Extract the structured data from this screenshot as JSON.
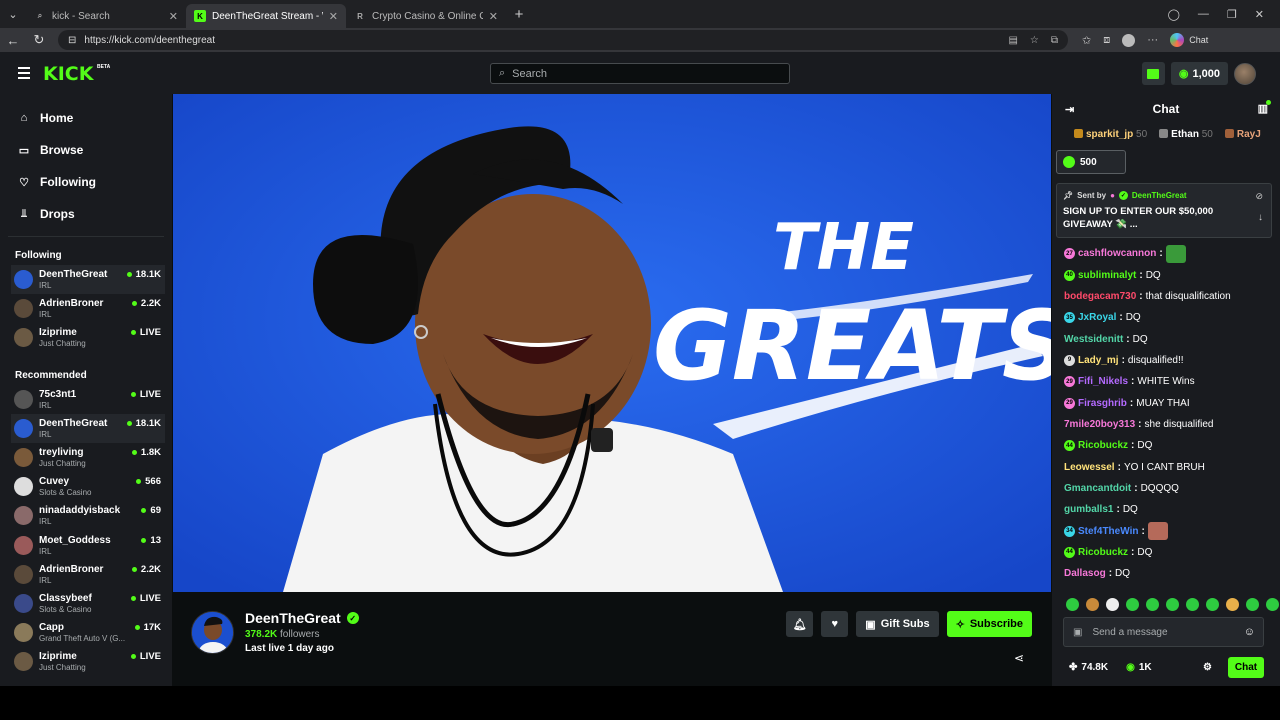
{
  "browser": {
    "tabs": [
      {
        "title": "kick - Search",
        "active": false,
        "favicon": "search-icon"
      },
      {
        "title": "DeenTheGreat Stream - Watch Live",
        "active": true,
        "favicon": "kick-logo-icon"
      },
      {
        "title": "Crypto Casino & Online Gambling",
        "active": false,
        "favicon": "casino-icon"
      }
    ],
    "url": "https://kick.com/deenthegreat",
    "copilot_label": "Chat"
  },
  "header": {
    "logo": "KICK",
    "beta": "BETA",
    "search_placeholder": "Search",
    "coins": "1,000"
  },
  "sidebar": {
    "nav": [
      {
        "label": "Home",
        "icon": "home-icon"
      },
      {
        "label": "Browse",
        "icon": "browse-icon"
      },
      {
        "label": "Following",
        "icon": "heart-icon"
      },
      {
        "label": "Drops",
        "icon": "drops-icon"
      }
    ],
    "following_title": "Following",
    "following": [
      {
        "name": "DeenTheGreat",
        "category": "IRL",
        "viewers": "18.1K",
        "selected": true,
        "color": "#2a5cd0"
      },
      {
        "name": "AdrienBroner",
        "category": "IRL",
        "viewers": "2.2K",
        "selected": false,
        "color": "#5a4a3a"
      },
      {
        "name": "Iziprime",
        "category": "Just Chatting",
        "viewers": "LIVE",
        "selected": false,
        "color": "#6b5a44"
      }
    ],
    "recommended_title": "Recommended",
    "recommended": [
      {
        "name": "75c3nt1",
        "category": "IRL",
        "viewers": "LIVE",
        "selected": false,
        "color": "#555"
      },
      {
        "name": "DeenTheGreat",
        "category": "IRL",
        "viewers": "18.1K",
        "selected": true,
        "color": "#2a5cd0"
      },
      {
        "name": "treyliving",
        "category": "Just Chatting",
        "viewers": "1.8K",
        "selected": false,
        "color": "#7a5a3a"
      },
      {
        "name": "Cuvey",
        "category": "Slots & Casino",
        "viewers": "566",
        "selected": false,
        "color": "#ddd"
      },
      {
        "name": "ninadaddyisback",
        "category": "IRL",
        "viewers": "69",
        "selected": false,
        "color": "#8a6a6a"
      },
      {
        "name": "Moet_Goddess",
        "category": "IRL",
        "viewers": "13",
        "selected": false,
        "color": "#9a5a5a"
      },
      {
        "name": "AdrienBroner",
        "category": "IRL",
        "viewers": "2.2K",
        "selected": false,
        "color": "#5a4a3a"
      },
      {
        "name": "Classybeef",
        "category": "Slots & Casino",
        "viewers": "LIVE",
        "selected": false,
        "color": "#3a4a8a"
      },
      {
        "name": "Capp",
        "category": "Grand Theft Auto V (G...",
        "viewers": "17K",
        "selected": false,
        "color": "#8a7a5a"
      },
      {
        "name": "Iziprime",
        "category": "Just Chatting",
        "viewers": "LIVE",
        "selected": false,
        "color": "#6b5a44"
      }
    ]
  },
  "player": {
    "title_line1": "THE",
    "title_line2": "GREATS"
  },
  "streamer": {
    "name": "DeenTheGreat",
    "followers": "378.2K",
    "followers_label": "followers",
    "last_live": "Last live 1 day ago",
    "gift_label": "Gift Subs",
    "subscribe_label": "Subscribe"
  },
  "chat": {
    "title": "Chat",
    "top_gifters": [
      {
        "name": "sparkit_jp",
        "count": "50"
      },
      {
        "name": "Ethan",
        "count": "50"
      },
      {
        "name": "RayJ",
        "count": ""
      }
    ],
    "gift_amount": "500",
    "pinned": {
      "sent_by": "Sent by",
      "user": "DeenTheGreat",
      "message": "SIGN UP TO ENTER OUR $50,000 GIVEAWAY 💸 ..."
    },
    "messages": [
      {
        "badge": "27",
        "badge_color": "#f778d8",
        "user": "cashflowcannon",
        "text": "",
        "user_color": "#f778d8",
        "emote": "#3a9a3a"
      },
      {
        "badge": "40",
        "badge_color": "#53fc18",
        "user": "subliminalyt",
        "text": "DQ",
        "user_color": "#53fc18",
        "emote": ""
      },
      {
        "badge": "",
        "badge_color": "",
        "user": "bodegacam730",
        "text": "that disqualification",
        "user_color": "#ff4a6a",
        "emote": ""
      },
      {
        "badge": "35",
        "badge_color": "#3ad6e8",
        "user": "JxRoyal",
        "text": "DQ",
        "user_color": "#3ad6e8",
        "emote": ""
      },
      {
        "badge": "",
        "badge_color": "",
        "user": "Westsidenitt",
        "text": "DQ",
        "user_color": "#53d6a8",
        "emote": ""
      },
      {
        "badge": "9",
        "badge_color": "#ddd",
        "user": "Lady_mj",
        "text": "disqualified!!",
        "user_color": "#ffe27a",
        "emote": ""
      },
      {
        "badge": "29",
        "badge_color": "#f778d8",
        "user": "Fifi_Nikels",
        "text": "WHITE Wins",
        "user_color": "#b46aff",
        "emote": ""
      },
      {
        "badge": "29",
        "badge_color": "#f778d8",
        "user": "Firasghrib",
        "text": "MUAY THAI",
        "user_color": "#b46aff",
        "emote": ""
      },
      {
        "badge": "",
        "badge_color": "",
        "user": "7mile20boy313",
        "text": "she disqualified",
        "user_color": "#f778d8",
        "emote": ""
      },
      {
        "badge": "44",
        "badge_color": "#53fc18",
        "user": "Ricobuckz",
        "text": "DQ",
        "user_color": "#53fc18",
        "emote": ""
      },
      {
        "badge": "",
        "badge_color": "",
        "user": "Leowessel",
        "text": "YO I CANT BRUH",
        "user_color": "#ffe27a",
        "emote": ""
      },
      {
        "badge": "",
        "badge_color": "",
        "user": "Gmancantdoit",
        "text": "DQQQQ",
        "user_color": "#53d6a8",
        "emote": ""
      },
      {
        "badge": "",
        "badge_color": "",
        "user": "gumballs1",
        "text": "DQ",
        "user_color": "#53d6a8",
        "emote": ""
      },
      {
        "badge": "34",
        "badge_color": "#3ad6e8",
        "user": "Stef4TheWin",
        "text": "",
        "user_color": "#4a8aff",
        "emote": "#b56a5a"
      },
      {
        "badge": "44",
        "badge_color": "#53fc18",
        "user": "Ricobuckz",
        "text": "DQ",
        "user_color": "#53fc18",
        "emote": ""
      },
      {
        "badge": "",
        "badge_color": "",
        "user": "Dallasog",
        "text": "DQ",
        "user_color": "#f778d8",
        "emote": ""
      }
    ],
    "send_placeholder": "Send a message",
    "viewers": "74.8K",
    "points": "1K",
    "chat_button": "Chat"
  },
  "colors": {
    "brand": "#53fc18",
    "bg": "#0b0e0f",
    "panel": "#191b1f",
    "stream_bg": "#1c5be0"
  }
}
